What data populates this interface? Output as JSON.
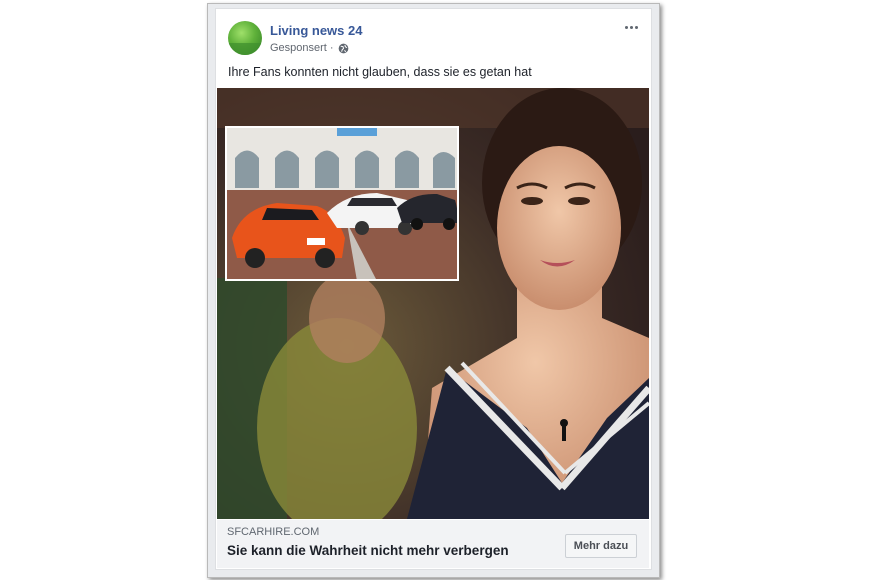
{
  "post": {
    "page_name": "Living news 24",
    "sponsored_label": "Gesponsert ·",
    "text": "Ihre Fans konnten nicht glauben, dass sie es getan hat",
    "more_icon": "more-horizontal-icon",
    "audience_icon": "globe-icon"
  },
  "link": {
    "domain": "SFCARHIRE.COM",
    "headline": "Sie kann die Wahrheit nicht mehr verbergen",
    "cta_label": "Mehr dazu"
  },
  "colors": {
    "page_name": "#385898",
    "card_bg": "#ffffff",
    "link_bar_bg": "#f2f3f5",
    "car_orange": "#e8541b"
  }
}
